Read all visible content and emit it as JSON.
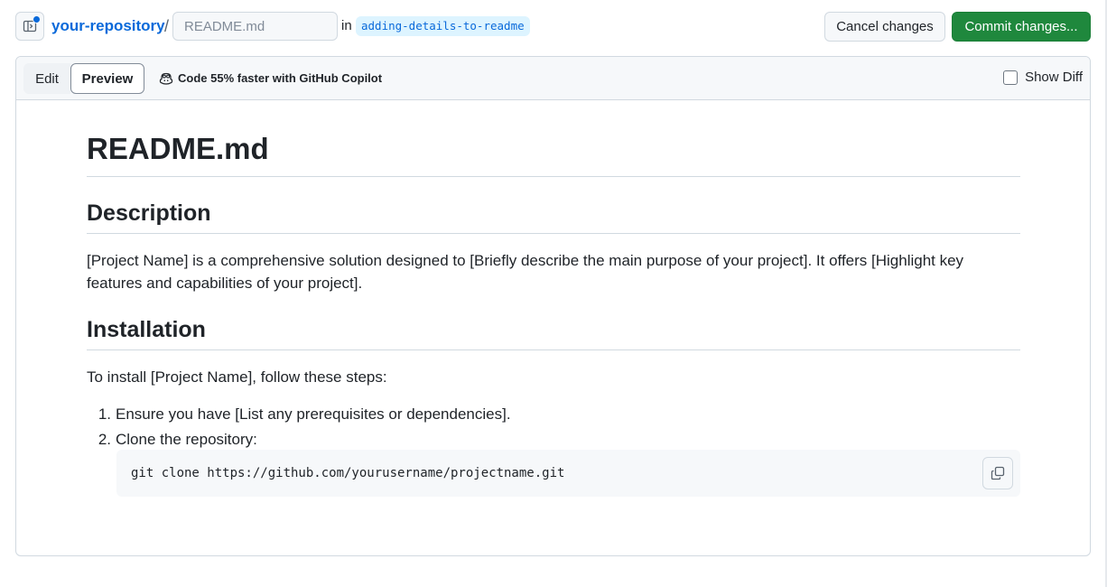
{
  "header": {
    "repo_name": "your-repository",
    "separator": "/",
    "filename_placeholder": "README.md",
    "in_label": "in",
    "branch_name": "adding-details-to-readme",
    "cancel_label": "Cancel changes",
    "commit_label": "Commit changes..."
  },
  "editor": {
    "tabs": [
      {
        "label": "Edit",
        "active": false
      },
      {
        "label": "Preview",
        "active": true
      }
    ],
    "copilot_text": "Code 55% faster with GitHub Copilot",
    "show_diff_label": "Show Diff",
    "show_diff_checked": false
  },
  "preview": {
    "title": "README.md",
    "sections": [
      {
        "heading": "Description",
        "text": "[Project Name] is a comprehensive solution designed to [Briefly describe the main purpose of your project]. It offers [Highlight key features and capabilities of your project]."
      },
      {
        "heading": "Installation",
        "text": "To install [Project Name], follow these steps:"
      }
    ],
    "steps": [
      {
        "num": "1.",
        "text": "Ensure you have [List any prerequisites or dependencies]."
      },
      {
        "num": "2.",
        "text": "Clone the repository:"
      }
    ],
    "code": "git clone https://github.com/yourusername/projectname.git"
  },
  "colors": {
    "accent": "#0969da",
    "commit_green": "#1f883d",
    "border": "#d1d9e0",
    "header_bg": "#f6f8fa"
  },
  "icons": {
    "sidebar_toggle": "sidebar-expand-icon",
    "copilot": "copilot-icon",
    "copy": "copy-icon"
  }
}
